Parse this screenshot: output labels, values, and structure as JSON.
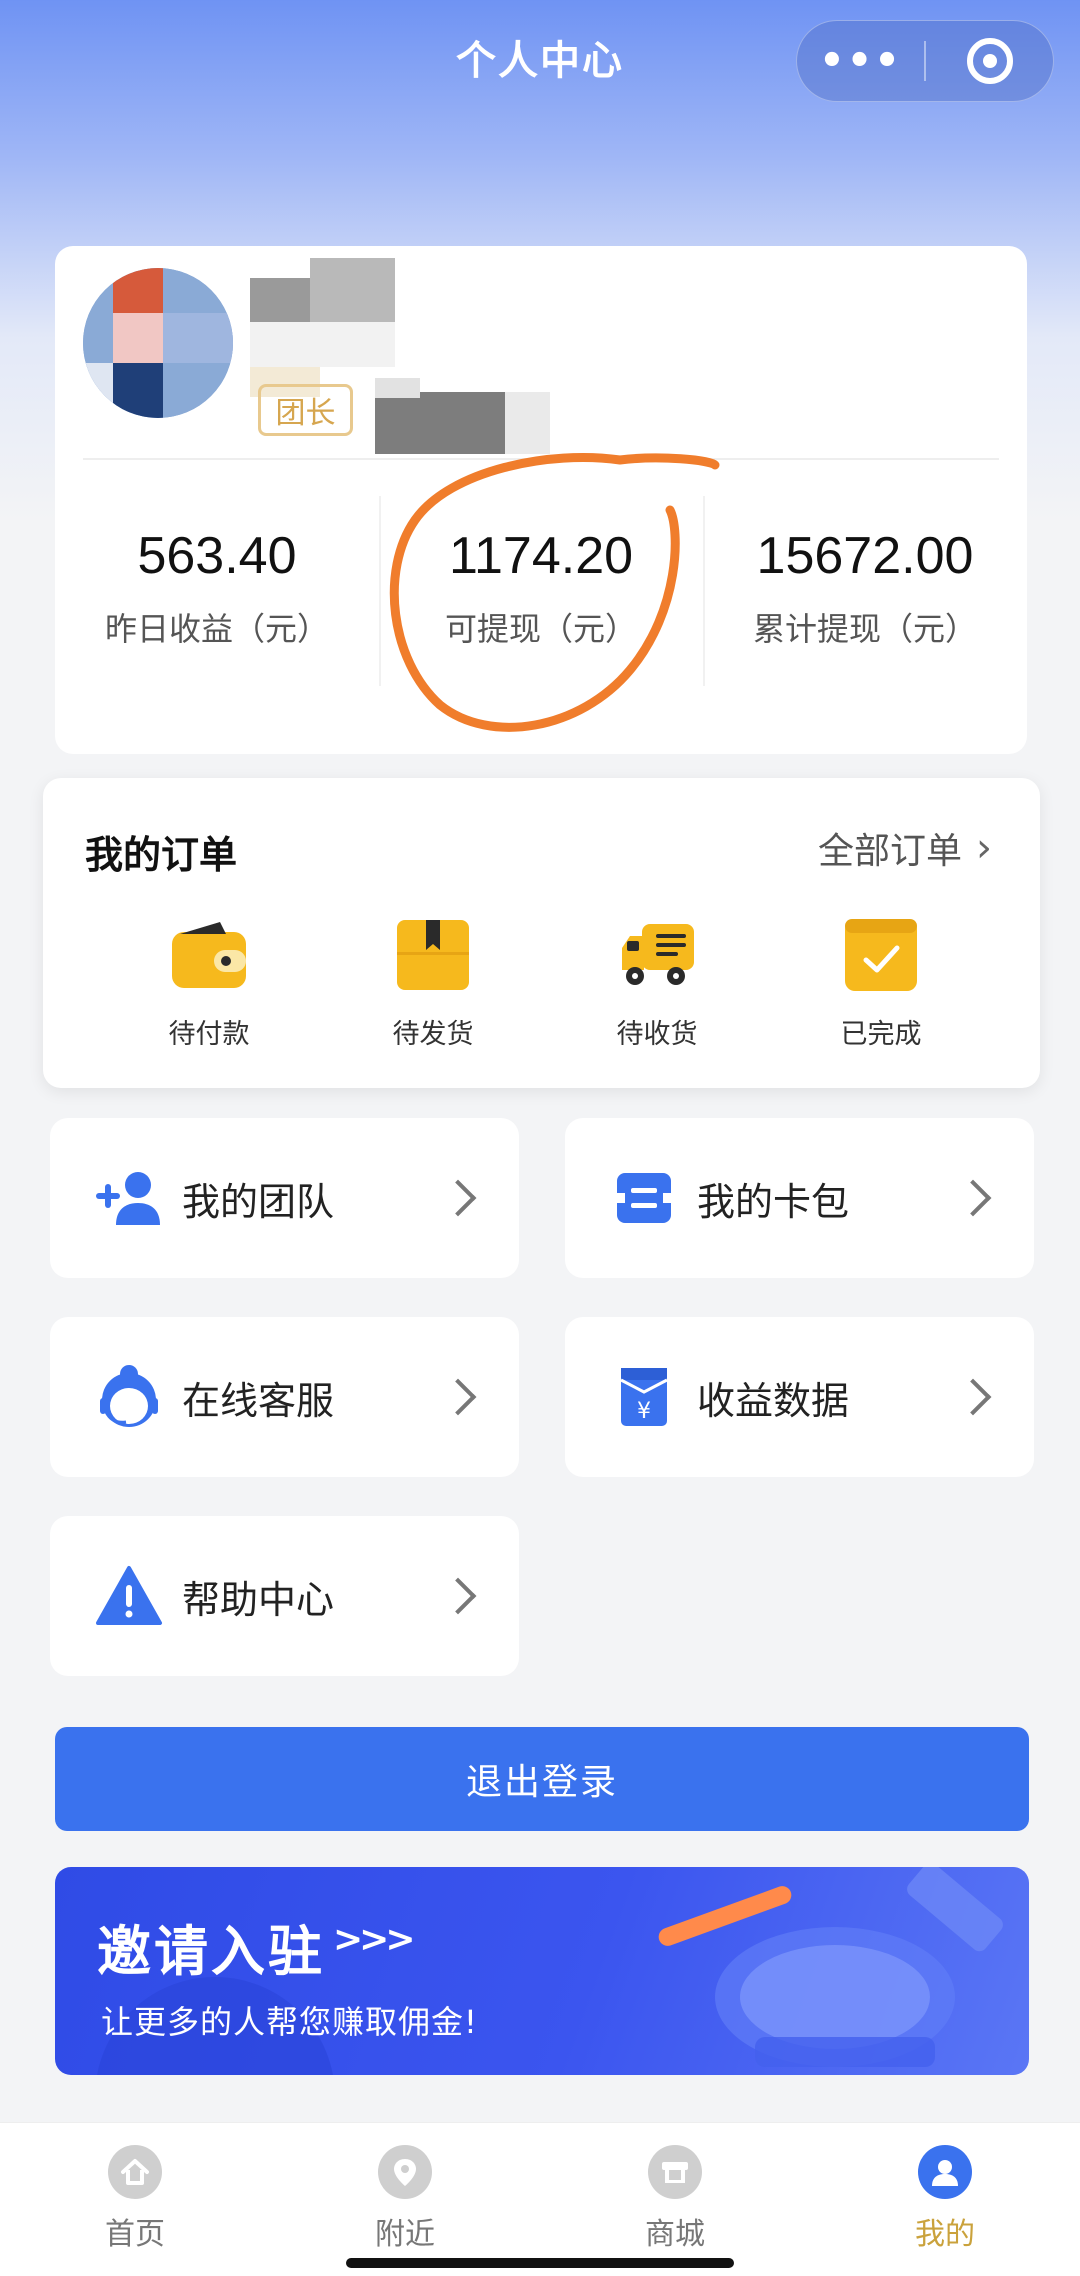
{
  "nav": {
    "title": "个人中心",
    "more_label": "•••"
  },
  "profile": {
    "badge": "团长",
    "stats": [
      {
        "value": "563.40",
        "label": "昨日收益（元）"
      },
      {
        "value": "1174.20",
        "label": "可提现（元）"
      },
      {
        "value": "15672.00",
        "label": "累计提现（元）"
      }
    ]
  },
  "orders": {
    "title": "我的订单",
    "all_label": "全部订单",
    "items": [
      {
        "label": "待付款",
        "icon": "wallet-icon"
      },
      {
        "label": "待发货",
        "icon": "box-icon"
      },
      {
        "label": "待收货",
        "icon": "truck-icon"
      },
      {
        "label": "已完成",
        "icon": "check-card-icon"
      }
    ]
  },
  "menu": [
    {
      "label": "我的团队",
      "icon": "add-user-icon"
    },
    {
      "label": "我的卡包",
      "icon": "card-icon"
    },
    {
      "label": "在线客服",
      "icon": "support-agent-icon"
    },
    {
      "label": "收益数据",
      "icon": "yuan-doc-icon"
    },
    {
      "label": "帮助中心",
      "icon": "warning-icon"
    }
  ],
  "logout_label": "退出登录",
  "banner": {
    "title": "邀请入驻",
    "arrows": ">>>",
    "subtitle": "让更多的人帮您赚取佣金!"
  },
  "tabs": [
    {
      "label": "首页",
      "icon": "home-icon"
    },
    {
      "label": "附近",
      "icon": "location-icon"
    },
    {
      "label": "商城",
      "icon": "shop-icon"
    },
    {
      "label": "我的",
      "icon": "user-icon",
      "active": true
    }
  ],
  "colors": {
    "primary": "#3a72ee",
    "accent_gold": "#caa23c",
    "icon_yellow": "#f6b91d",
    "annotation_orange": "#f07d2c"
  }
}
